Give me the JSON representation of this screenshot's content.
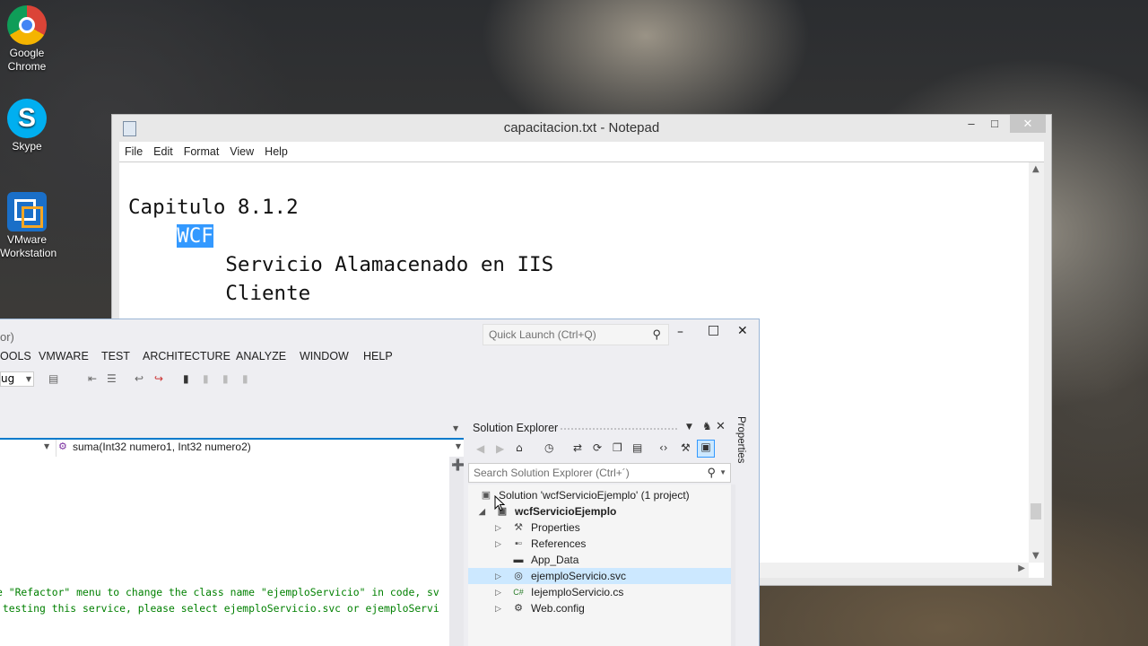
{
  "desktop": {
    "icons": [
      {
        "label_1": "Google",
        "label_2": "Chrome",
        "icon": "chrome-icon"
      },
      {
        "label_1": "Skype",
        "label_2": "",
        "icon": "skype-icon"
      },
      {
        "label_1": "VMware",
        "label_2": "Workstation",
        "icon": "vmware-icon"
      }
    ]
  },
  "notepad": {
    "title": "capacitacion.txt - Notepad",
    "menu": [
      "File",
      "Edit",
      "Format",
      "View",
      "Help"
    ],
    "lines": {
      "l1": "Capitulo 8.1.2",
      "l2_selected": "WCF",
      "l3": "Servicio Alamacenado en IIS",
      "l4": "Cliente"
    }
  },
  "vs": {
    "title_fragment": "or)",
    "quick_launch_placeholder": "Quick Launch (Ctrl+Q)",
    "menu": [
      "OOLS",
      "VMWARE",
      "TEST",
      "ARCHITECTURE",
      "ANALYZE",
      "WINDOW",
      "HELP"
    ],
    "config_fragment": "ug",
    "member_dropdown": "suma(Int32 numero1, Int32 numero2)",
    "code_lines": [
      "e \"Refactor\" menu to change the class name \"ejemploServicio\" in code, sv",
      " testing this service, please select ejemploServicio.svc or ejemploServi"
    ],
    "solution_explorer": {
      "title": "Solution Explorer",
      "side_tab": "Properties",
      "search_placeholder": "Search Solution Explorer (Ctrl+´)",
      "nodes": [
        {
          "label": "Solution 'wcfServicioEjemplo' (1 project)",
          "icon": "solution-icon",
          "expanded": null
        },
        {
          "label": "wcfServicioEjemplo",
          "icon": "web-project-icon",
          "expanded": true
        },
        {
          "label": "Properties",
          "icon": "wrench-icon",
          "expanded": false
        },
        {
          "label": "References",
          "icon": "references-icon",
          "expanded": false
        },
        {
          "label": "App_Data",
          "icon": "folder-icon",
          "expanded": null
        },
        {
          "label": "ejemploServicio.svc",
          "icon": "svc-file-icon",
          "expanded": false,
          "selected": true
        },
        {
          "label": "IejemploServicio.cs",
          "icon": "csharp-file-icon",
          "expanded": false
        },
        {
          "label": "Web.config",
          "icon": "config-file-icon",
          "expanded": false
        }
      ]
    }
  },
  "colors": {
    "selection": "#3399ff",
    "vs_accent": "#007acc",
    "code_comment": "#008000",
    "selected_row": "#cce8ff"
  }
}
